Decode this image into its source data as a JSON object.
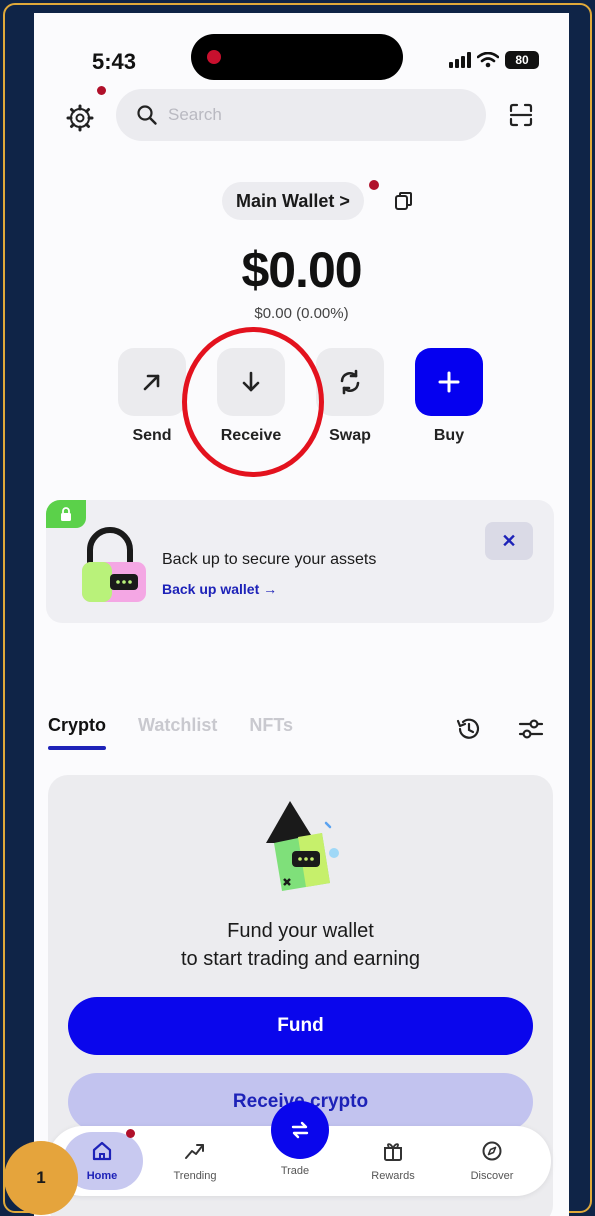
{
  "status_bar": {
    "time": "5:43",
    "battery": "80"
  },
  "search": {
    "placeholder": "Search"
  },
  "wallet": {
    "name": "Main Wallet >"
  },
  "balance": {
    "amount": "$0.00",
    "change": "$0.00 (0.00%)"
  },
  "actions": [
    {
      "label": "Send",
      "icon": "arrow-up-right-icon"
    },
    {
      "label": "Receive",
      "icon": "arrow-down-icon"
    },
    {
      "label": "Swap",
      "icon": "swap-icon"
    },
    {
      "label": "Buy",
      "icon": "plus-icon"
    }
  ],
  "backup_banner": {
    "title": "Back up to secure your assets",
    "link": "Back up wallet →",
    "close": "✕"
  },
  "asset_tabs": {
    "crypto": "Crypto",
    "watchlist": "Watchlist",
    "nfts": "NFTs",
    "active": "Crypto"
  },
  "fund_card": {
    "title_line1": "Fund your wallet",
    "title_line2": "to start trading and earning",
    "fund_button": "Fund",
    "receive_button": "Receive crypto"
  },
  "tab_bar": {
    "home": "Home",
    "trending": "Trending",
    "trade": "Trade",
    "rewards": "Rewards",
    "discover": "Discover",
    "active": "Home"
  },
  "annotation": {
    "step": "1"
  },
  "colors": {
    "brand": "#0a06ec",
    "highlight_circle": "#e3121e",
    "notification_dot": "#b0102a",
    "badge": "#e5a43c"
  }
}
